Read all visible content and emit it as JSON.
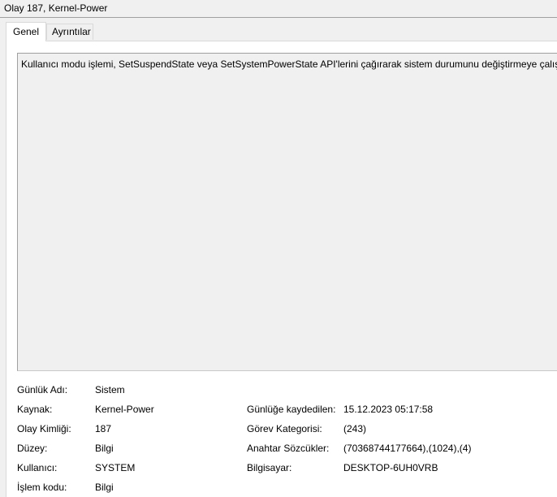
{
  "window": {
    "title": "Olay 187, Kernel-Power"
  },
  "tabs": [
    {
      "label": "Genel",
      "active": true
    },
    {
      "label": "Ayrıntılar",
      "active": false
    }
  ],
  "description": "Kullanıcı modu işlemi, SetSuspendState veya SetSystemPowerState API'lerini çağırarak sistem durumunu değiştirmeye çalıştı.",
  "fields": {
    "log_name": {
      "label": "Günlük Adı:",
      "value": "Sistem"
    },
    "source": {
      "label": "Kaynak:",
      "value": "Kernel-Power"
    },
    "logged": {
      "label": "Günlüğe kaydedilen:",
      "value": "15.12.2023 05:17:58"
    },
    "event_id": {
      "label": "Olay Kimliği:",
      "value": "187"
    },
    "task_category": {
      "label": "Görev Kategorisi:",
      "value": "(243)"
    },
    "level": {
      "label": "Düzey:",
      "value": "Bilgi"
    },
    "keywords": {
      "label": "Anahtar Sözcükler:",
      "value": "(70368744177664),(1024),(4)"
    },
    "user": {
      "label": "Kullanıcı:",
      "value": "SYSTEM"
    },
    "computer": {
      "label": "Bilgisayar:",
      "value": "DESKTOP-6UH0VRB"
    },
    "opcode": {
      "label": "İşlem kodu:",
      "value": "Bilgi"
    }
  }
}
